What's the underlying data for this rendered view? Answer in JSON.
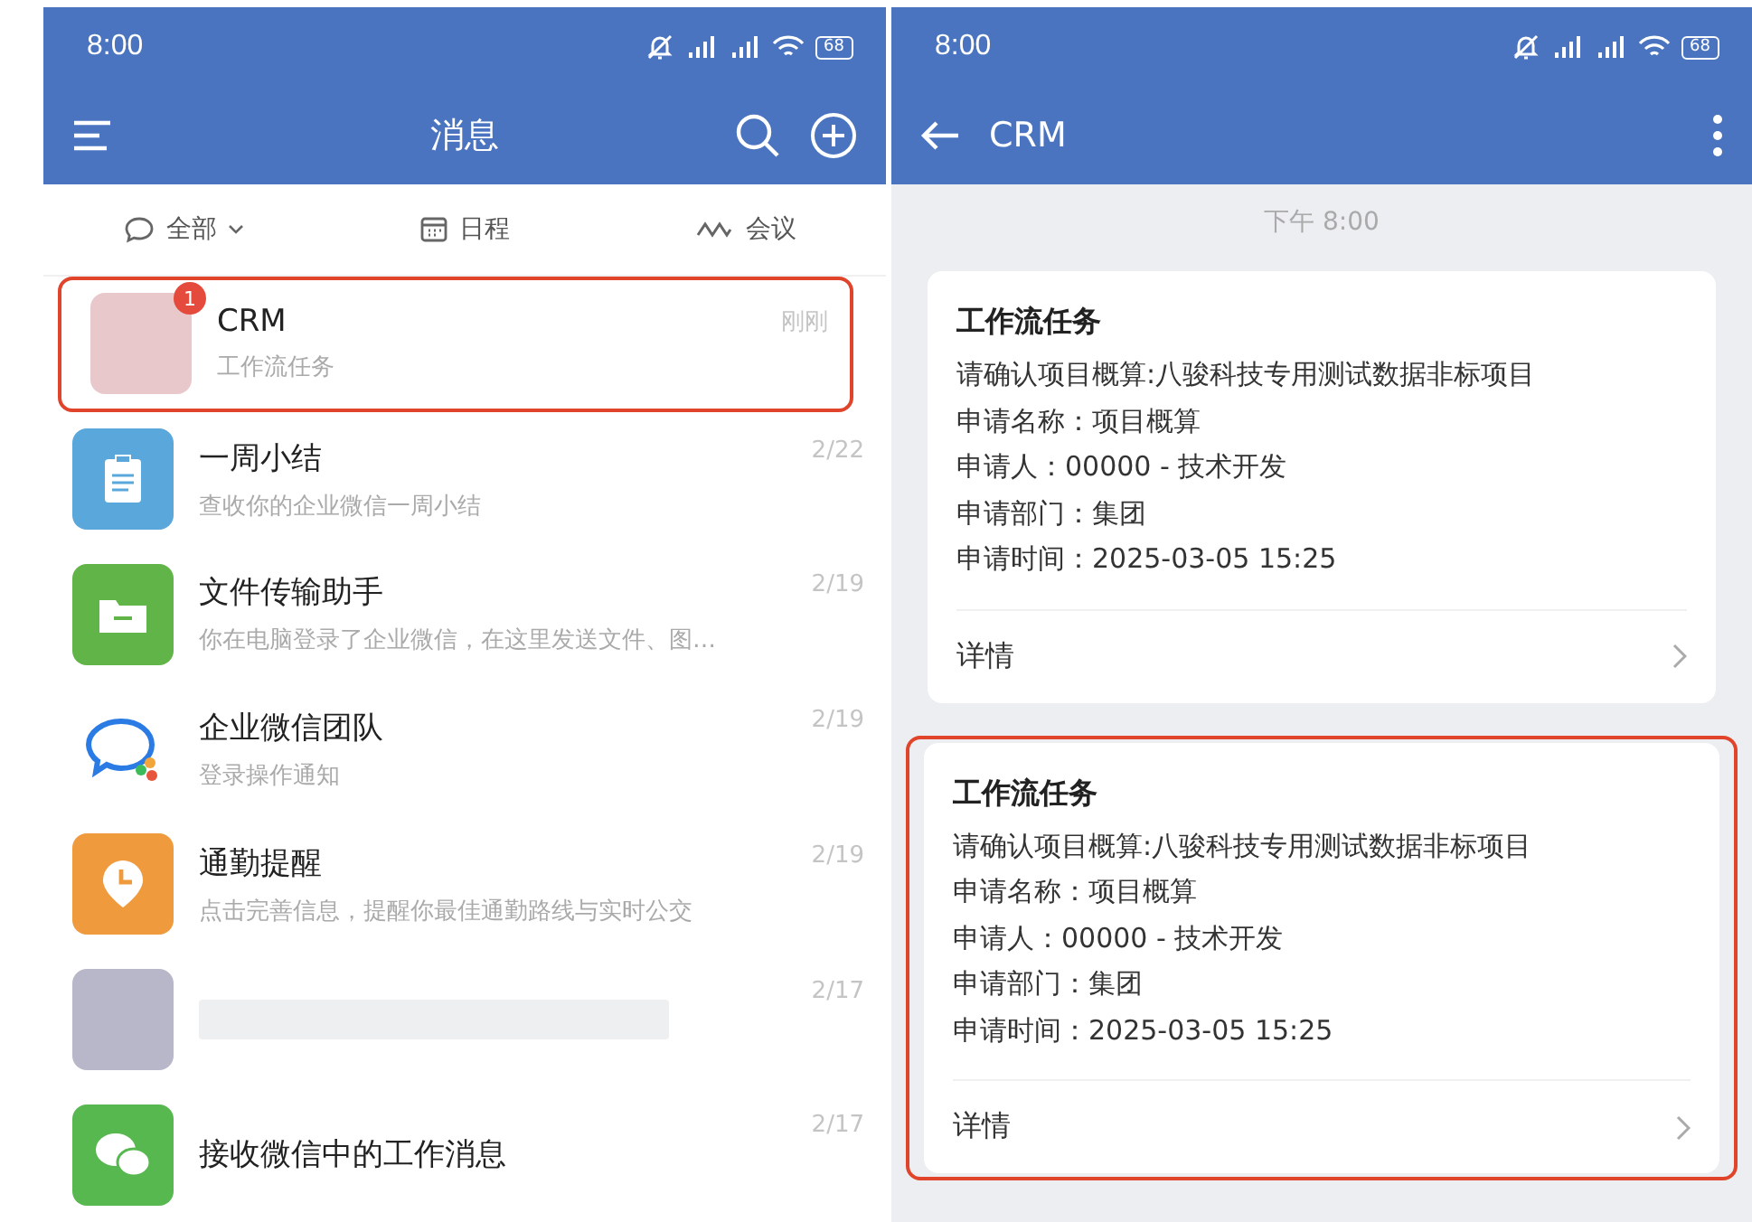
{
  "left": {
    "status": {
      "time": "8:00",
      "battery": "68"
    },
    "header": {
      "title": "消息"
    },
    "filters": [
      {
        "kind": "chat",
        "label": "全部",
        "has_menu": true
      },
      {
        "kind": "calendar",
        "label": "日程",
        "has_menu": false
      },
      {
        "kind": "meeting",
        "label": "会议",
        "has_menu": false
      }
    ],
    "conversations": [
      {
        "kind": "blurred-avatar",
        "name": "CRM",
        "preview": "工作流任务",
        "time": "刚刚",
        "badge": "1",
        "highlighted": true
      },
      {
        "kind": "clipboard",
        "name": "一周小结",
        "preview": "查收你的企业微信一周小结",
        "time": "2/22",
        "highlighted": false
      },
      {
        "kind": "folder",
        "name": "文件传输助手",
        "preview": "你在电脑登录了企业微信，在这里发送文件、图…",
        "time": "2/19",
        "highlighted": false
      },
      {
        "kind": "chatlogo",
        "name": "企业微信团队",
        "preview": "登录操作通知",
        "time": "2/19",
        "highlighted": false
      },
      {
        "kind": "clockpin",
        "name": "通勤提醒",
        "preview": "点击完善信息，提醒你最佳通勤路线与实时公交",
        "time": "2/19",
        "highlighted": false
      },
      {
        "kind": "blurred",
        "time": "2/17",
        "highlighted": false
      },
      {
        "kind": "wechat",
        "name": "接收微信中的工作消息",
        "time": "2/17",
        "highlighted": false
      }
    ]
  },
  "right": {
    "status": {
      "time": "8:00",
      "battery": "68"
    },
    "header": {
      "title": "CRM"
    },
    "time_divider": "下午 8:00",
    "cards": [
      {
        "title": "工作流任务",
        "lines": [
          "请确认项目概算:八骏科技专用测试数据非标项目",
          "申请名称：项目概算",
          "申请人：00000 - 技术开发",
          "申请部门：集团",
          "申请时间：2025-03-05 15:25"
        ],
        "action": "详情",
        "highlighted": false
      },
      {
        "title": "工作流任务",
        "lines": [
          "请确认项目概算:八骏科技专用测试数据非标项目",
          "申请名称：项目概算",
          "申请人：00000 - 技术开发",
          "申请部门：集团",
          "申请时间：2025-03-05 15:25"
        ],
        "action": "详情",
        "highlighted": true
      }
    ]
  }
}
